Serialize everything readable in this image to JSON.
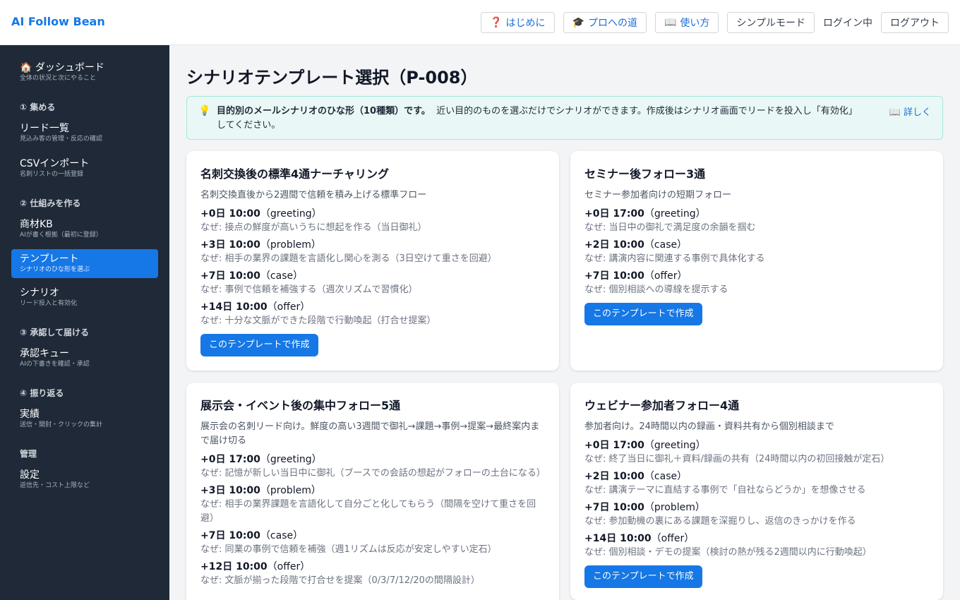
{
  "header": {
    "brand": "AI Follow Bean",
    "nav": [
      {
        "icon": "question-icon",
        "glyph": "❓",
        "label": "はじめに"
      },
      {
        "icon": "graduation-cap-icon",
        "glyph": "🎓",
        "label": "プロへの道"
      },
      {
        "icon": "book-icon",
        "glyph": "📖",
        "label": "使い方"
      }
    ],
    "simple_mode": "シンプルモード",
    "login_status": "ログイン中",
    "logout": "ログアウト"
  },
  "sidebar": {
    "dashboard": {
      "glyph": "🏠",
      "title": "ダッシュボード",
      "sub": "全体の状況と次にやること"
    },
    "sections": [
      {
        "label": "① 集める",
        "items": [
          {
            "title": "リード一覧",
            "sub": "見込み客の管理・反応の確認"
          },
          {
            "title": "CSVインポート",
            "sub": "名刺リストの一括登録"
          }
        ]
      },
      {
        "label": "② 仕組みを作る",
        "items": [
          {
            "title": "商材KB",
            "sub": "AIが書く根拠（最初に登録）"
          },
          {
            "title": "テンプレート",
            "sub": "シナリオのひな形を選ぶ"
          },
          {
            "title": "シナリオ",
            "sub": "リード投入と有効化"
          }
        ]
      },
      {
        "label": "③ 承認して届ける",
        "items": [
          {
            "title": "承認キュー",
            "sub": "AIの下書きを確認・承認"
          }
        ]
      },
      {
        "label": "④ 振り返る",
        "items": [
          {
            "title": "実績",
            "sub": "送信・開封・クリックの集計"
          }
        ]
      },
      {
        "label": "管理",
        "items": [
          {
            "title": "設定",
            "sub": "返信先・コスト上限など"
          }
        ]
      }
    ]
  },
  "main": {
    "title": "シナリオテンプレート選択（P-008）",
    "tip": {
      "glyph": "💡",
      "bold": "目的別のメールシナリオのひな形（10種類）です。",
      "text": "近い目的のものを選ぶだけでシナリオができます。作成後はシナリオ画面でリードを投入し「有効化」してください。",
      "more_glyph": "📖",
      "more": "詳しく"
    },
    "create_label": "このテンプレートで作成",
    "cards": [
      {
        "title": "名刺交換後の標準4通ナーチャリング",
        "desc": "名刺交換直後から2週間で信頼を積み上げる標準フロー",
        "steps": [
          {
            "when": "+0日 10:00",
            "type": "（greeting）",
            "why": "なぜ: 接点の鮮度が高いうちに想起を作る（当日御礼）"
          },
          {
            "when": "+3日 10:00",
            "type": "（problem）",
            "why": "なぜ: 相手の業界の課題を言語化し関心を測る（3日空けて重さを回避）"
          },
          {
            "when": "+7日 10:00",
            "type": "（case）",
            "why": "なぜ: 事例で信頼を補強する（週次リズムで習慣化）"
          },
          {
            "when": "+14日 10:00",
            "type": "（offer）",
            "why": "なぜ: 十分な文脈ができた段階で行動喚起（打合せ提案）"
          }
        ]
      },
      {
        "title": "セミナー後フォロー3通",
        "desc": "セミナー参加者向けの短期フォロー",
        "steps": [
          {
            "when": "+0日 17:00",
            "type": "（greeting）",
            "why": "なぜ: 当日中の御礼で満足度の余韻を掴む"
          },
          {
            "when": "+2日 10:00",
            "type": "（case）",
            "why": "なぜ: 講演内容に関連する事例で具体化する"
          },
          {
            "when": "+7日 10:00",
            "type": "（offer）",
            "why": "なぜ: 個別相談への導線を提示する"
          }
        ]
      },
      {
        "title": "展示会・イベント後の集中フォロー5通",
        "desc": "展示会の名刺リード向け。鮮度の高い3週間で御礼→課題→事例→提案→最終案内まで届け切る",
        "steps": [
          {
            "when": "+0日 17:00",
            "type": "（greeting）",
            "why": "なぜ: 記憶が新しい当日中に御礼（ブースでの会話の想起がフォローの土台になる）"
          },
          {
            "when": "+3日 10:00",
            "type": "（problem）",
            "why": "なぜ: 相手の業界課題を言語化して自分ごと化してもらう（間隔を空けて重さを回避）"
          },
          {
            "when": "+7日 10:00",
            "type": "（case）",
            "why": "なぜ: 同業の事例で信頼を補強（週1リズムは反応が安定しやすい定石）"
          },
          {
            "when": "+12日 10:00",
            "type": "（offer）",
            "why": "なぜ: 文脈が揃った段階で打合せを提案（0/3/7/12/20の間隔設計）"
          }
        ]
      },
      {
        "title": "ウェビナー参加者フォロー4通",
        "desc": "参加者向け。24時間以内の録画・資料共有から個別相談まで",
        "steps": [
          {
            "when": "+0日 17:00",
            "type": "（greeting）",
            "why": "なぜ: 終了当日に御礼＋資料/録画の共有（24時間以内の初回接触が定石）"
          },
          {
            "when": "+2日 10:00",
            "type": "（case）",
            "why": "なぜ: 講演テーマに直結する事例で「自社ならどうか」を想像させる"
          },
          {
            "when": "+7日 10:00",
            "type": "（problem）",
            "why": "なぜ: 参加動機の裏にある課題を深掘りし、返信のきっかけを作る"
          },
          {
            "when": "+14日 10:00",
            "type": "（offer）",
            "why": "なぜ: 個別相談・デモの提案（検討の熱が残る2週間以内に行動喚起）"
          }
        ]
      }
    ]
  },
  "colors": {
    "accent": "#1677e6",
    "sidebar_bg": "#1f2937",
    "tip_bg": "#e9f8f6"
  }
}
